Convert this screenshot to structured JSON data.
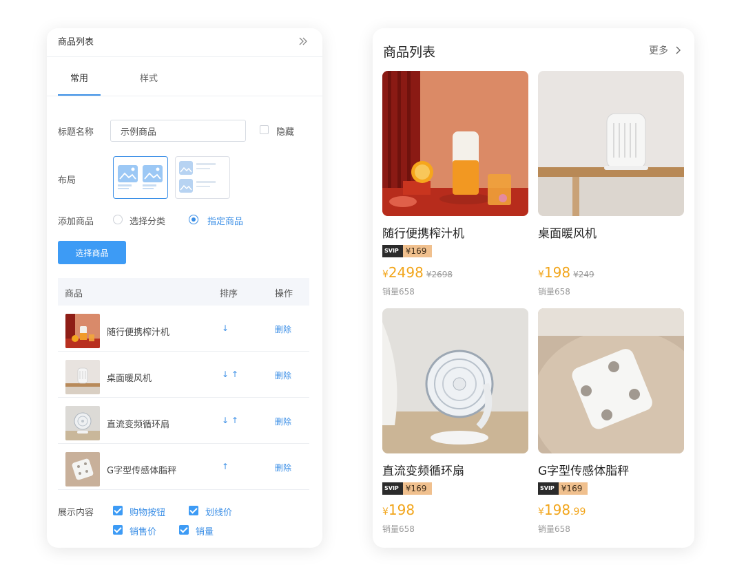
{
  "editor": {
    "title": "商品列表",
    "tabs": [
      {
        "label": "常用"
      },
      {
        "label": "样式"
      }
    ],
    "title_field": {
      "label": "标题名称",
      "value": "示例商品",
      "hide_label": "隐藏",
      "hidden": false
    },
    "layout": {
      "label": "布局",
      "selected": "two-column"
    },
    "add_product": {
      "label": "添加商品",
      "options": [
        {
          "label": "选择分类",
          "selected": false
        },
        {
          "label": "指定商品",
          "selected": true
        }
      ]
    },
    "select_button": "选择商品",
    "table": {
      "headers": [
        "商品",
        "排序",
        "操作"
      ],
      "rows": [
        {
          "name": "随行便携榨汁机",
          "sort": "↓",
          "action": "删除"
        },
        {
          "name": "桌面暖风机",
          "sort": "↓↑",
          "action": "删除"
        },
        {
          "name": "直流变频循环扇",
          "sort": "↓↑",
          "action": "删除"
        },
        {
          "name": "G字型传感体脂秤",
          "sort": "↑",
          "action": "删除"
        }
      ]
    },
    "display": {
      "label": "展示内容",
      "options": [
        {
          "label": "购物按钮",
          "checked": true
        },
        {
          "label": "划线价",
          "checked": true
        },
        {
          "label": "销售价",
          "checked": true
        },
        {
          "label": "销量",
          "checked": true
        }
      ]
    }
  },
  "preview": {
    "title": "商品列表",
    "more": "更多",
    "products": [
      {
        "name": "随行便携榨汁机",
        "svip_tag": "SVIP",
        "svip_price": "¥169",
        "currency": "¥",
        "price_int": "2498",
        "price_dec": "",
        "old_price": "¥2698",
        "sales": "销量658"
      },
      {
        "name": "桌面暖风机",
        "svip_tag": "",
        "svip_price": "",
        "currency": "¥",
        "price_int": "198",
        "price_dec": "",
        "old_price": "¥249",
        "sales": "销量658"
      },
      {
        "name": "直流变频循环扇",
        "svip_tag": "SVIP",
        "svip_price": "¥169",
        "currency": "¥",
        "price_int": "198",
        "price_dec": "",
        "old_price": "",
        "sales": "销量658"
      },
      {
        "name": "G字型传感体脂秤",
        "svip_tag": "SVIP",
        "svip_price": "¥169",
        "currency": "¥",
        "price_int": "198",
        "price_dec": ".99",
        "old_price": "",
        "sales": "销量658"
      }
    ]
  },
  "colors": {
    "accent": "#3a8ee6",
    "button": "#3d9bf5",
    "price": "#f2a51a",
    "svip_gold": "#f0c08e",
    "svip_dark": "#2b2b2b"
  },
  "icons": [
    "double-chevron-right-icon",
    "chevron-right-icon",
    "image-placeholder-icon"
  ]
}
